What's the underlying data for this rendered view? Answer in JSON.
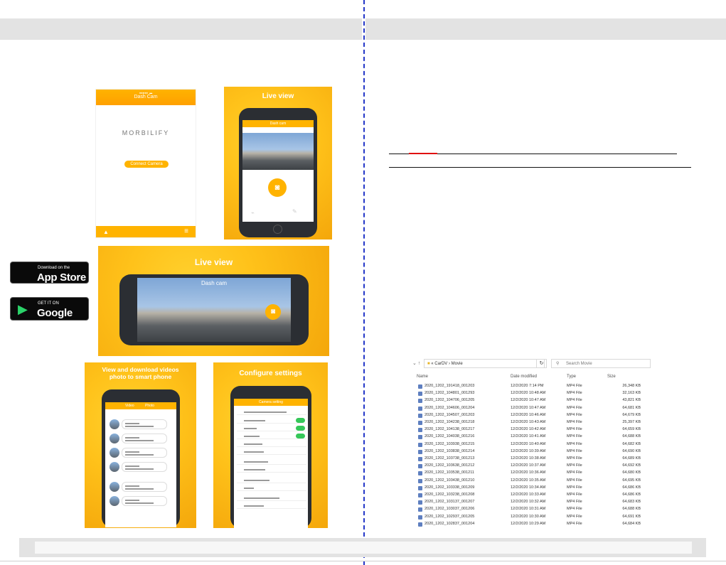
{
  "colors": {
    "header_gray": "#e3e3e3",
    "divider_blue": "#2437c8",
    "accent_yellow": "#ffb300",
    "red_mark": "#e01010"
  },
  "app_screen": {
    "title": "Dash Cam",
    "brand": "MORBILIFY",
    "connect_button": "Connect Camera",
    "icons": [
      "gallery-icon",
      "menu-icon"
    ]
  },
  "panels": {
    "live_view_portrait": {
      "title": "Live view",
      "screen_header": "Dash cam"
    },
    "live_view_landscape": {
      "title": "Live view",
      "screen_header": "Dash cam"
    },
    "download": {
      "title_line1": "View and download videos",
      "title_line2": "photo to smart phone",
      "tab_left": "Video",
      "tab_right": "Photo"
    },
    "settings": {
      "title": "Configure settings",
      "screen_header": "Camera setting"
    }
  },
  "store_badges": {
    "app_store": {
      "small": "Download on the",
      "big": "App Store"
    },
    "google_play": {
      "small": "GET IT ON",
      "big": "Google Play"
    }
  },
  "file_browser": {
    "path": [
      "CarDV",
      "Movie"
    ],
    "search_placeholder": "Search Movie",
    "columns": [
      "Name",
      "Date modified",
      "Type",
      "Size"
    ],
    "rows": [
      [
        "2020_1202_191418_001203",
        "12/2/2020 7:14 PM",
        "MP4 File",
        "26,348 KB"
      ],
      [
        "2020_1202_104801_001293",
        "12/2/2020 10:48 AM",
        "MP4 File",
        "32,163 KB"
      ],
      [
        "2020_1202_104706_001205",
        "12/2/2020 10:47 AM",
        "MP4 File",
        "43,821 KB"
      ],
      [
        "2020_1202_104606_001204",
        "12/2/2020 10:47 AM",
        "MP4 File",
        "64,681 KB"
      ],
      [
        "2020_1202_104507_001203",
        "12/2/2020 10:46 AM",
        "MP4 File",
        "64,679 KB"
      ],
      [
        "2020_1202_104238_001218",
        "12/2/2020 10:43 AM",
        "MP4 File",
        "25,397 KB"
      ],
      [
        "2020_1202_104138_001217",
        "12/2/2020 10:42 AM",
        "MP4 File",
        "64,659 KB"
      ],
      [
        "2020_1202_104038_001216",
        "12/2/2020 10:41 AM",
        "MP4 File",
        "64,688 KB"
      ],
      [
        "2020_1202_103938_001215",
        "12/2/2020 10:40 AM",
        "MP4 File",
        "64,682 KB"
      ],
      [
        "2020_1202_103838_001214",
        "12/2/2020 10:39 AM",
        "MP4 File",
        "64,690 KB"
      ],
      [
        "2020_1202_103738_001213",
        "12/2/2020 10:38 AM",
        "MP4 File",
        "64,689 KB"
      ],
      [
        "2020_1202_103638_001212",
        "12/2/2020 10:37 AM",
        "MP4 File",
        "64,692 KB"
      ],
      [
        "2020_1202_103538_001211",
        "12/2/2020 10:36 AM",
        "MP4 File",
        "64,680 KB"
      ],
      [
        "2020_1202_103438_001210",
        "12/2/2020 10:35 AM",
        "MP4 File",
        "64,695 KB"
      ],
      [
        "2020_1202_103338_001209",
        "12/2/2020 10:34 AM",
        "MP4 File",
        "64,686 KB"
      ],
      [
        "2020_1202_103238_001208",
        "12/2/2020 10:33 AM",
        "MP4 File",
        "64,686 KB"
      ],
      [
        "2020_1202_103137_001207",
        "12/2/2020 10:32 AM",
        "MP4 File",
        "64,683 KB"
      ],
      [
        "2020_1202_103037_001206",
        "12/2/2020 10:31 AM",
        "MP4 File",
        "64,688 KB"
      ],
      [
        "2020_1202_102937_001205",
        "12/2/2020 10:30 AM",
        "MP4 File",
        "64,691 KB"
      ],
      [
        "2020_1202_102837_001204",
        "12/2/2020 10:29 AM",
        "MP4 File",
        "64,684 KB"
      ]
    ]
  }
}
